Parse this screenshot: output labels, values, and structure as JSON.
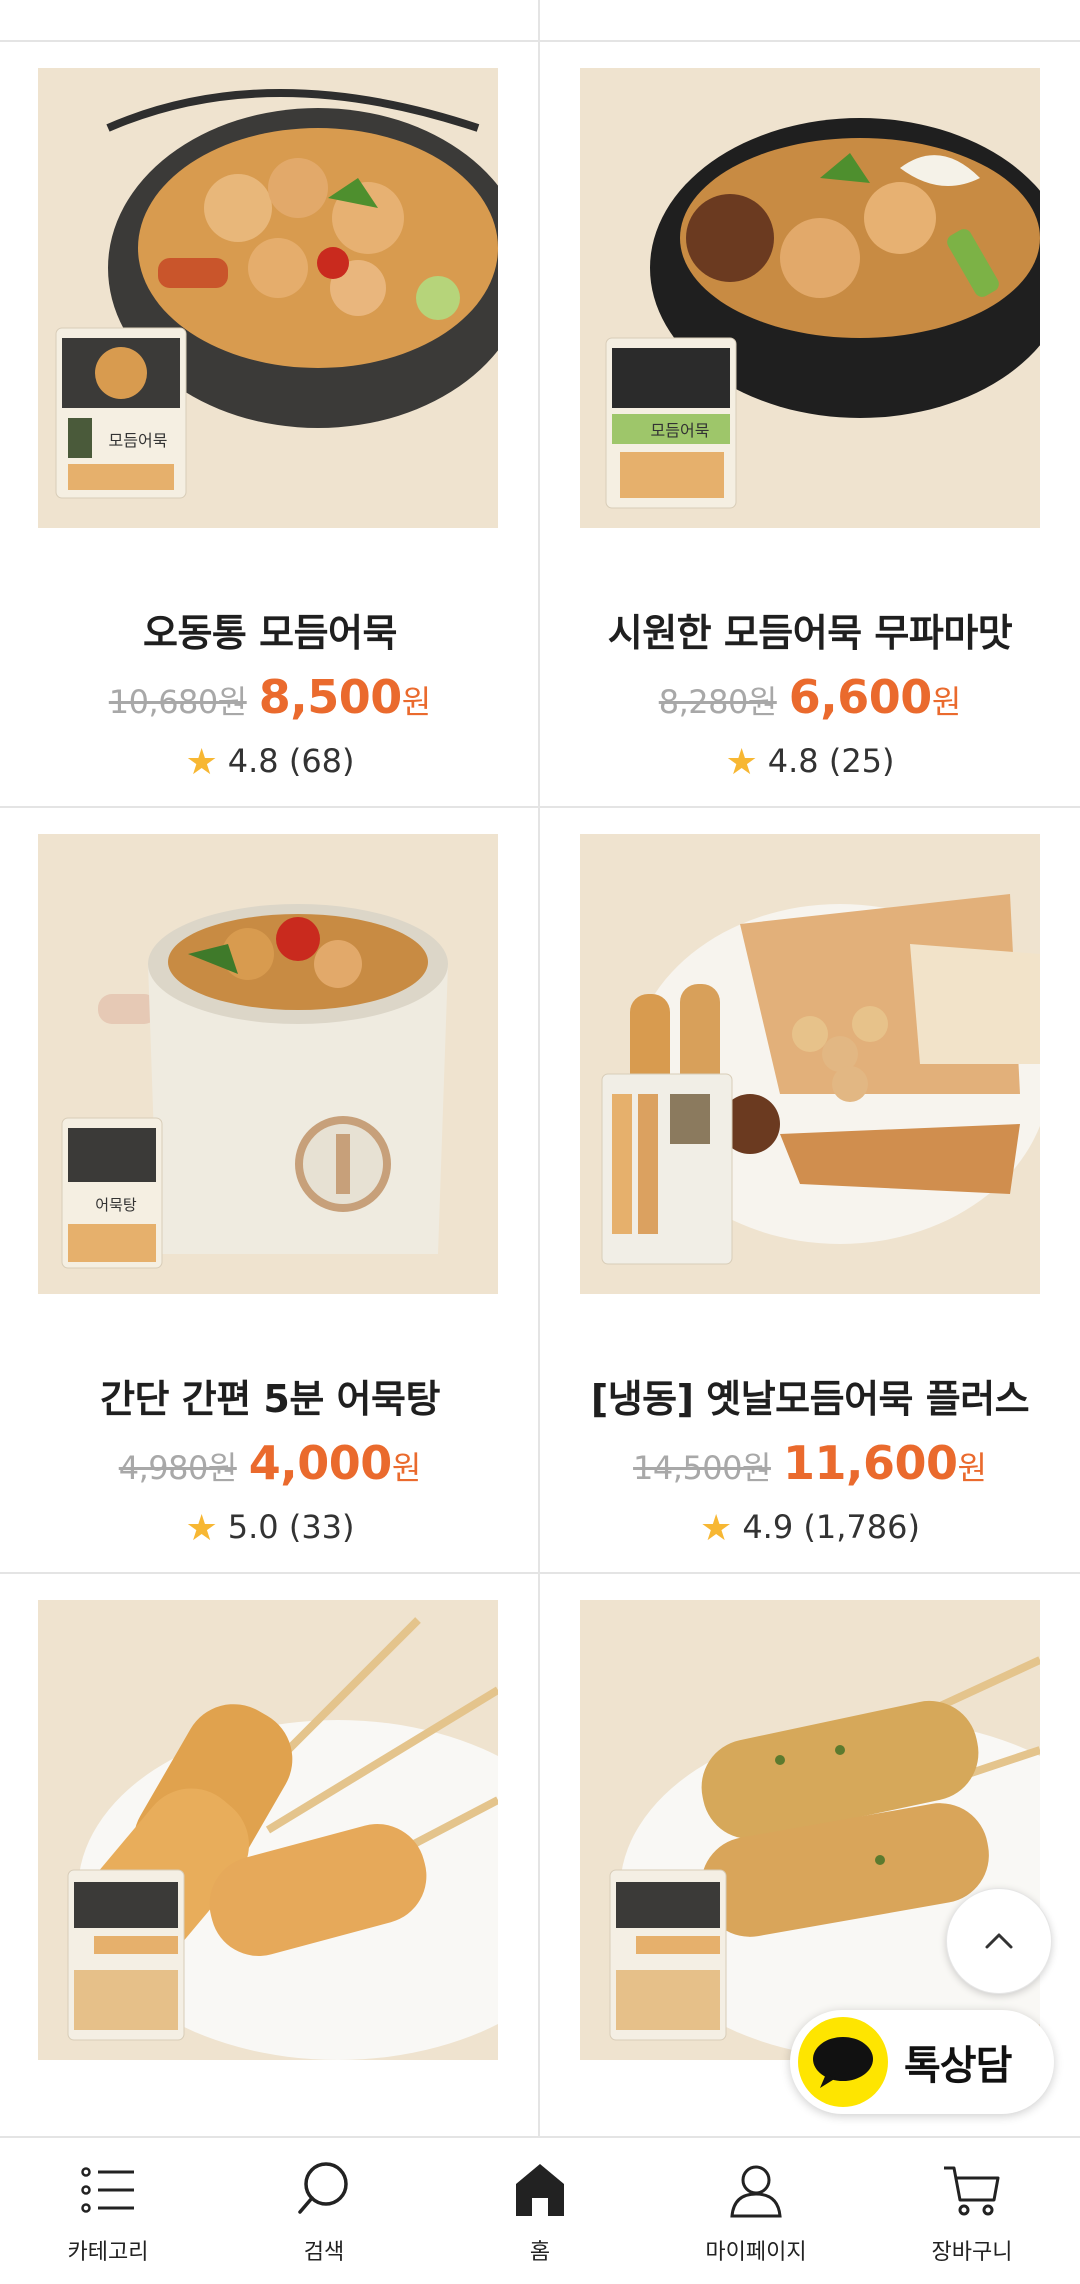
{
  "products": [
    {
      "name": "오동통 모듬어묵",
      "original_price": "10,680원",
      "sale_price": "8,500",
      "currency": "원",
      "rating": "4.8",
      "review_count": "(68)",
      "package_text": "모듬어묵"
    },
    {
      "name": "시원한 모듬어묵 무파마맛",
      "original_price": "8,280원",
      "sale_price": "6,600",
      "currency": "원",
      "rating": "4.8",
      "review_count": "(25)",
      "package_text": "모듬어묵"
    },
    {
      "name": "간단 간편 5분 어묵탕",
      "original_price": "4,980원",
      "sale_price": "4,000",
      "currency": "원",
      "rating": "5.0",
      "review_count": "(33)",
      "package_text": "어묵탕"
    },
    {
      "name": "[냉동] 옛날모듬어묵 플러스",
      "original_price": "14,500원",
      "sale_price": "11,600",
      "currency": "원",
      "rating": "4.9",
      "review_count": "(1,786)",
      "package_text": ""
    },
    {
      "name": "",
      "original_price": "",
      "sale_price": "",
      "currency": "",
      "rating": "",
      "review_count": "",
      "package_text": ""
    },
    {
      "name": "",
      "original_price": "",
      "sale_price": "",
      "currency": "",
      "rating": "",
      "review_count": "",
      "package_text": ""
    }
  ],
  "floating": {
    "talk_label": "톡상담"
  },
  "tabbar": [
    {
      "label": "카테고리",
      "icon": "menu-list-icon"
    },
    {
      "label": "검색",
      "icon": "search-icon"
    },
    {
      "label": "홈",
      "icon": "home-icon"
    },
    {
      "label": "마이페이지",
      "icon": "user-icon"
    },
    {
      "label": "장바구니",
      "icon": "cart-icon"
    }
  ],
  "colors": {
    "sale": "#ea6a2d",
    "star": "#f7b733",
    "kakao": "#fee500",
    "image_bg": "#efe4d0"
  }
}
